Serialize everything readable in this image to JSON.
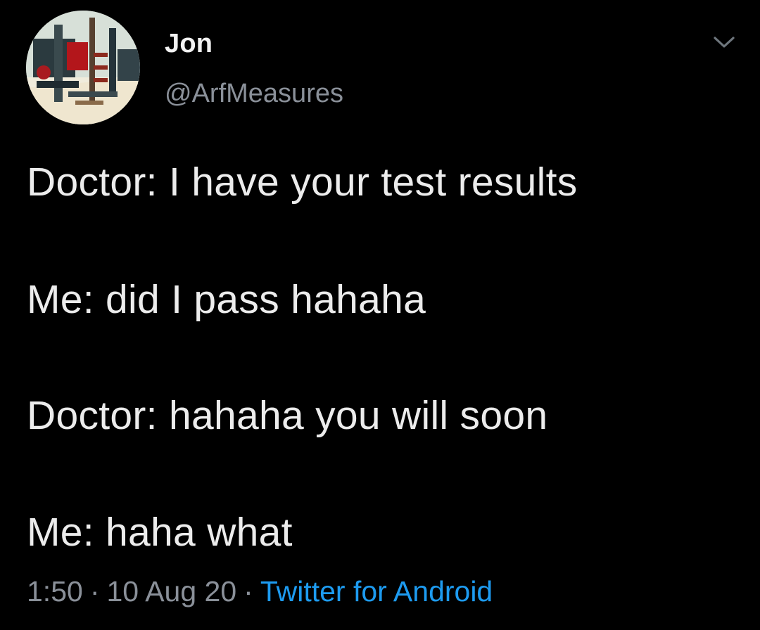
{
  "author": {
    "display_name": "Jon",
    "handle": "@ArfMeasures"
  },
  "tweet": {
    "lines": [
      "Doctor: I have your test results",
      "Me: did I pass hahaha",
      "Doctor: hahaha you will soon",
      "Me: haha what"
    ]
  },
  "meta": {
    "time": "1:50",
    "separator": "·",
    "date": "10 Aug 20",
    "source": "Twitter for Android"
  },
  "colors": {
    "background": "#000000",
    "text": "#ececec",
    "secondary": "#8a9099",
    "link": "#1d9bf0"
  },
  "icons": {
    "menu": "chevron-down-icon"
  }
}
